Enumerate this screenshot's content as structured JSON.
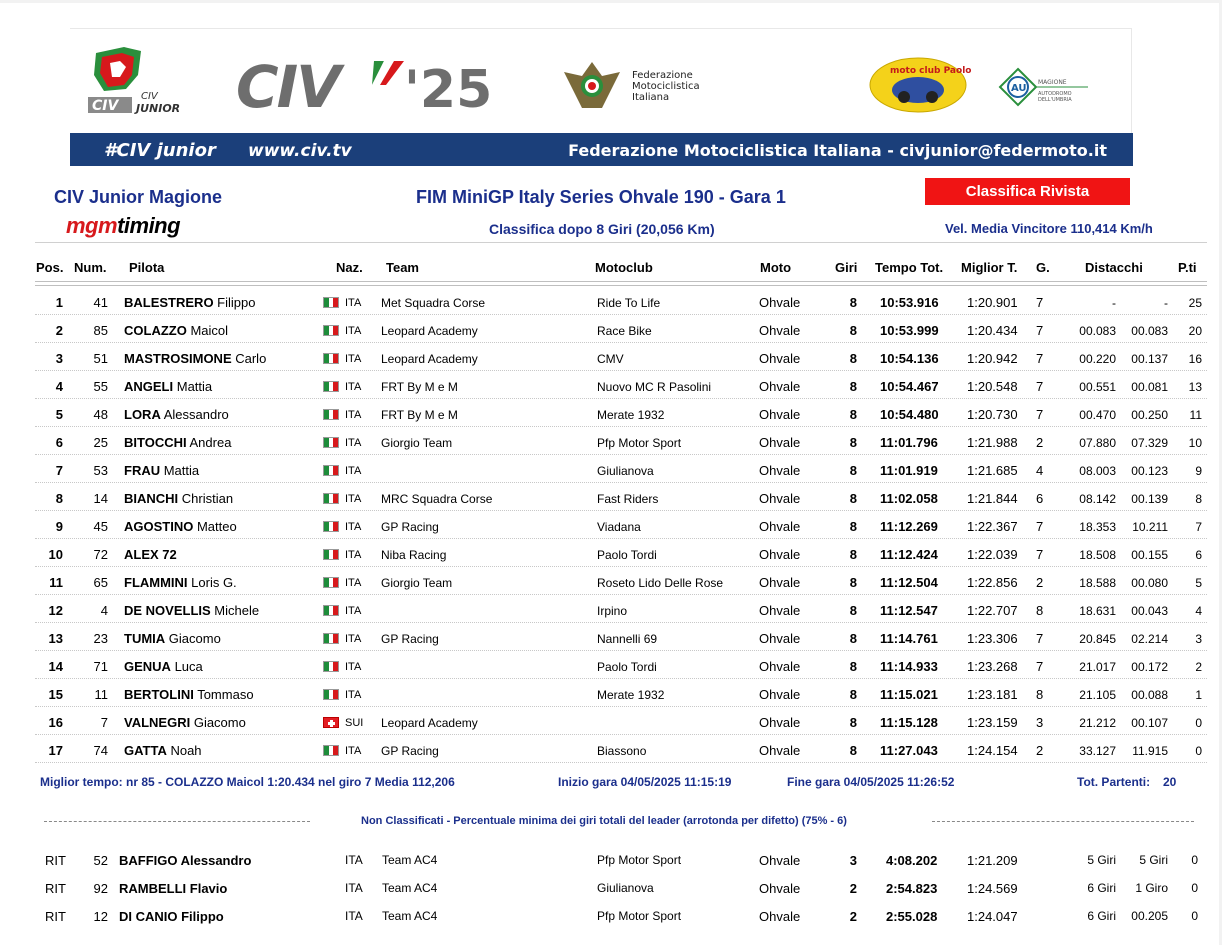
{
  "header": {
    "logo_civ_junior_text": "CIV JUNIOR",
    "logo_civ25_text": "CIV'25",
    "fmi_text_lines": [
      "Federazione",
      "Motociclistica",
      "Italiana"
    ],
    "moto_club_text": "moto club Paolo Tordi",
    "au_logo_text": "AU",
    "bar_hashtag": "#CIV junior",
    "bar_site": "www.civ.tv",
    "bar_federation": "Federazione Motociclistica Italiana - civjunior@federmoto.it"
  },
  "title": {
    "event": "CIV Junior Magione",
    "timing_brand_a": "mgm",
    "timing_brand_b": "timing",
    "race": "FIM MiniGP Italy Series Ohvale 190 - Gara 1",
    "subtitle": "Classifica dopo 8 Giri (20,056 Km)",
    "badge": "Classifica Rivista",
    "avg_speed": "Vel. Media Vincitore 110,414 Km/h"
  },
  "columns": {
    "pos": "Pos.",
    "num": "Num.",
    "pilota": "Pilota",
    "naz": "Naz.",
    "team": "Team",
    "motoclub": "Motoclub",
    "moto": "Moto",
    "giri": "Giri",
    "tempo": "Tempo Tot.",
    "miglior": "Miglior T.",
    "g": "G.",
    "distacchi": "Distacchi",
    "punti": "P.ti"
  },
  "results": [
    {
      "pos": "1",
      "num": "41",
      "surname": "BALESTRERO",
      "name": "Filippo",
      "flag": "ITA",
      "naz": "ITA",
      "team": "Met Squadra Corse",
      "motoclub": "Ride To Life",
      "moto": "Ohvale",
      "giri": "8",
      "tempo": "10:53.916",
      "miglior": "1:20.901",
      "g": "7",
      "d1": "-",
      "d2": "-",
      "pt": "25"
    },
    {
      "pos": "2",
      "num": "85",
      "surname": "COLAZZO",
      "name": "Maicol",
      "flag": "ITA",
      "naz": "ITA",
      "team": "Leopard Academy",
      "motoclub": "Race Bike",
      "moto": "Ohvale",
      "giri": "8",
      "tempo": "10:53.999",
      "miglior": "1:20.434",
      "g": "7",
      "d1": "00.083",
      "d2": "00.083",
      "pt": "20"
    },
    {
      "pos": "3",
      "num": "51",
      "surname": "MASTROSIMONE",
      "name": "Carlo",
      "flag": "ITA",
      "naz": "ITA",
      "team": "Leopard Academy",
      "motoclub": "CMV",
      "moto": "Ohvale",
      "giri": "8",
      "tempo": "10:54.136",
      "miglior": "1:20.942",
      "g": "7",
      "d1": "00.220",
      "d2": "00.137",
      "pt": "16"
    },
    {
      "pos": "4",
      "num": "55",
      "surname": "ANGELI",
      "name": "Mattia",
      "flag": "ITA",
      "naz": "ITA",
      "team": "FRT By M e M",
      "motoclub": "Nuovo MC R Pasolini",
      "moto": "Ohvale",
      "giri": "8",
      "tempo": "10:54.467",
      "miglior": "1:20.548",
      "g": "7",
      "d1": "00.551",
      "d2": "00.081",
      "pt": "13"
    },
    {
      "pos": "5",
      "num": "48",
      "surname": "LORA",
      "name": "Alessandro",
      "flag": "ITA",
      "naz": "ITA",
      "team": "FRT By M e M",
      "motoclub": "Merate 1932",
      "moto": "Ohvale",
      "giri": "8",
      "tempo": "10:54.480",
      "miglior": "1:20.730",
      "g": "7",
      "d1": "00.470",
      "d2": "00.250",
      "pt": "11"
    },
    {
      "pos": "6",
      "num": "25",
      "surname": "BITOCCHI",
      "name": "Andrea",
      "flag": "ITA",
      "naz": "ITA",
      "team": "Giorgio Team",
      "motoclub": "Pfp Motor Sport",
      "moto": "Ohvale",
      "giri": "8",
      "tempo": "11:01.796",
      "miglior": "1:21.988",
      "g": "2",
      "d1": "07.880",
      "d2": "07.329",
      "pt": "10"
    },
    {
      "pos": "7",
      "num": "53",
      "surname": "FRAU",
      "name": "Mattia",
      "flag": "ITA",
      "naz": "ITA",
      "team": "",
      "motoclub": "Giulianova",
      "moto": "Ohvale",
      "giri": "8",
      "tempo": "11:01.919",
      "miglior": "1:21.685",
      "g": "4",
      "d1": "08.003",
      "d2": "00.123",
      "pt": "9"
    },
    {
      "pos": "8",
      "num": "14",
      "surname": "BIANCHI",
      "name": "Christian",
      "flag": "ITA",
      "naz": "ITA",
      "team": "MRC Squadra Corse",
      "motoclub": "Fast Riders",
      "moto": "Ohvale",
      "giri": "8",
      "tempo": "11:02.058",
      "miglior": "1:21.844",
      "g": "6",
      "d1": "08.142",
      "d2": "00.139",
      "pt": "8"
    },
    {
      "pos": "9",
      "num": "45",
      "surname": "AGOSTINO",
      "name": "Matteo",
      "flag": "ITA",
      "naz": "ITA",
      "team": "GP Racing",
      "motoclub": "Viadana",
      "moto": "Ohvale",
      "giri": "8",
      "tempo": "11:12.269",
      "miglior": "1:22.367",
      "g": "7",
      "d1": "18.353",
      "d2": "10.211",
      "pt": "7"
    },
    {
      "pos": "10",
      "num": "72",
      "surname": "ALEX 72",
      "name": "",
      "flag": "ITA",
      "naz": "ITA",
      "team": "Niba Racing",
      "motoclub": "Paolo Tordi",
      "moto": "Ohvale",
      "giri": "8",
      "tempo": "11:12.424",
      "miglior": "1:22.039",
      "g": "7",
      "d1": "18.508",
      "d2": "00.155",
      "pt": "6"
    },
    {
      "pos": "11",
      "num": "65",
      "surname": "FLAMMINI",
      "name": "Loris G.",
      "flag": "ITA",
      "naz": "ITA",
      "team": "Giorgio Team",
      "motoclub": "Roseto Lido Delle Rose",
      "moto": "Ohvale",
      "giri": "8",
      "tempo": "11:12.504",
      "miglior": "1:22.856",
      "g": "2",
      "d1": "18.588",
      "d2": "00.080",
      "pt": "5"
    },
    {
      "pos": "12",
      "num": "4",
      "surname": "DE NOVELLIS",
      "name": "Michele",
      "flag": "ITA",
      "naz": "ITA",
      "team": "",
      "motoclub": "Irpino",
      "moto": "Ohvale",
      "giri": "8",
      "tempo": "11:12.547",
      "miglior": "1:22.707",
      "g": "8",
      "d1": "18.631",
      "d2": "00.043",
      "pt": "4"
    },
    {
      "pos": "13",
      "num": "23",
      "surname": "TUMIA",
      "name": "Giacomo",
      "flag": "ITA",
      "naz": "ITA",
      "team": "GP Racing",
      "motoclub": "Nannelli 69",
      "moto": "Ohvale",
      "giri": "8",
      "tempo": "11:14.761",
      "miglior": "1:23.306",
      "g": "7",
      "d1": "20.845",
      "d2": "02.214",
      "pt": "3"
    },
    {
      "pos": "14",
      "num": "71",
      "surname": "GENUA",
      "name": "Luca",
      "flag": "ITA",
      "naz": "ITA",
      "team": "",
      "motoclub": "Paolo Tordi",
      "moto": "Ohvale",
      "giri": "8",
      "tempo": "11:14.933",
      "miglior": "1:23.268",
      "g": "7",
      "d1": "21.017",
      "d2": "00.172",
      "pt": "2"
    },
    {
      "pos": "15",
      "num": "11",
      "surname": "BERTOLINI",
      "name": "Tommaso",
      "flag": "ITA",
      "naz": "ITA",
      "team": "",
      "motoclub": "Merate 1932",
      "moto": "Ohvale",
      "giri": "8",
      "tempo": "11:15.021",
      "miglior": "1:23.181",
      "g": "8",
      "d1": "21.105",
      "d2": "00.088",
      "pt": "1"
    },
    {
      "pos": "16",
      "num": "7",
      "surname": "VALNEGRI",
      "name": "Giacomo",
      "flag": "SUI",
      "naz": "SUI",
      "team": "Leopard Academy",
      "motoclub": "",
      "moto": "Ohvale",
      "giri": "8",
      "tempo": "11:15.128",
      "miglior": "1:23.159",
      "g": "3",
      "d1": "21.212",
      "d2": "00.107",
      "pt": "0"
    },
    {
      "pos": "17",
      "num": "74",
      "surname": "GATTA",
      "name": "Noah",
      "flag": "ITA",
      "naz": "ITA",
      "team": "GP Racing",
      "motoclub": "Biassono",
      "moto": "Ohvale",
      "giri": "8",
      "tempo": "11:27.043",
      "miglior": "1:24.154",
      "g": "2",
      "d1": "33.127",
      "d2": "11.915",
      "pt": "0"
    }
  ],
  "footer": {
    "best_lap": "Miglior tempo: nr 85 - COLAZZO Maicol 1:20.434 nel giro 7 Media 112,206",
    "start": "Inizio gara 04/05/2025 11:15:19",
    "end": "Fine gara 04/05/2025 11:26:52",
    "starters_label": "Tot. Partenti:",
    "starters_value": "20"
  },
  "non_classified": {
    "title": "Non Classificati - Percentuale minima dei giri totali del leader (arrotonda per difetto) (75% - 6)",
    "rows": [
      {
        "pos": "RIT",
        "num": "52",
        "pilota": "BAFFIGO Alessandro",
        "naz": "ITA",
        "team": "Team AC4",
        "motoclub": "Pfp Motor Sport",
        "moto": "Ohvale",
        "giri": "3",
        "tempo": "4:08.202",
        "miglior": "1:21.209",
        "d1": "5 Giri",
        "d2": "5 Giri",
        "pt": "0"
      },
      {
        "pos": "RIT",
        "num": "92",
        "pilota": "RAMBELLI Flavio",
        "naz": "ITA",
        "team": "Team AC4",
        "motoclub": "Giulianova",
        "moto": "Ohvale",
        "giri": "2",
        "tempo": "2:54.823",
        "miglior": "1:24.569",
        "d1": "6 Giri",
        "d2": "1 Giro",
        "pt": "0"
      },
      {
        "pos": "RIT",
        "num": "12",
        "pilota": "DI CANIO Filippo",
        "naz": "ITA",
        "team": "Team AC4",
        "motoclub": "Pfp Motor Sport",
        "moto": "Ohvale",
        "giri": "2",
        "tempo": "2:55.028",
        "miglior": "1:24.047",
        "d1": "6 Giri",
        "d2": "00.205",
        "pt": "0"
      }
    ]
  },
  "colors": {
    "title_blue": "#1b2f8c",
    "bar_blue": "#1b3f7a",
    "badge_red": "#f01414",
    "flag_green": "#1e8c3a",
    "flag_red": "#d7191c"
  }
}
